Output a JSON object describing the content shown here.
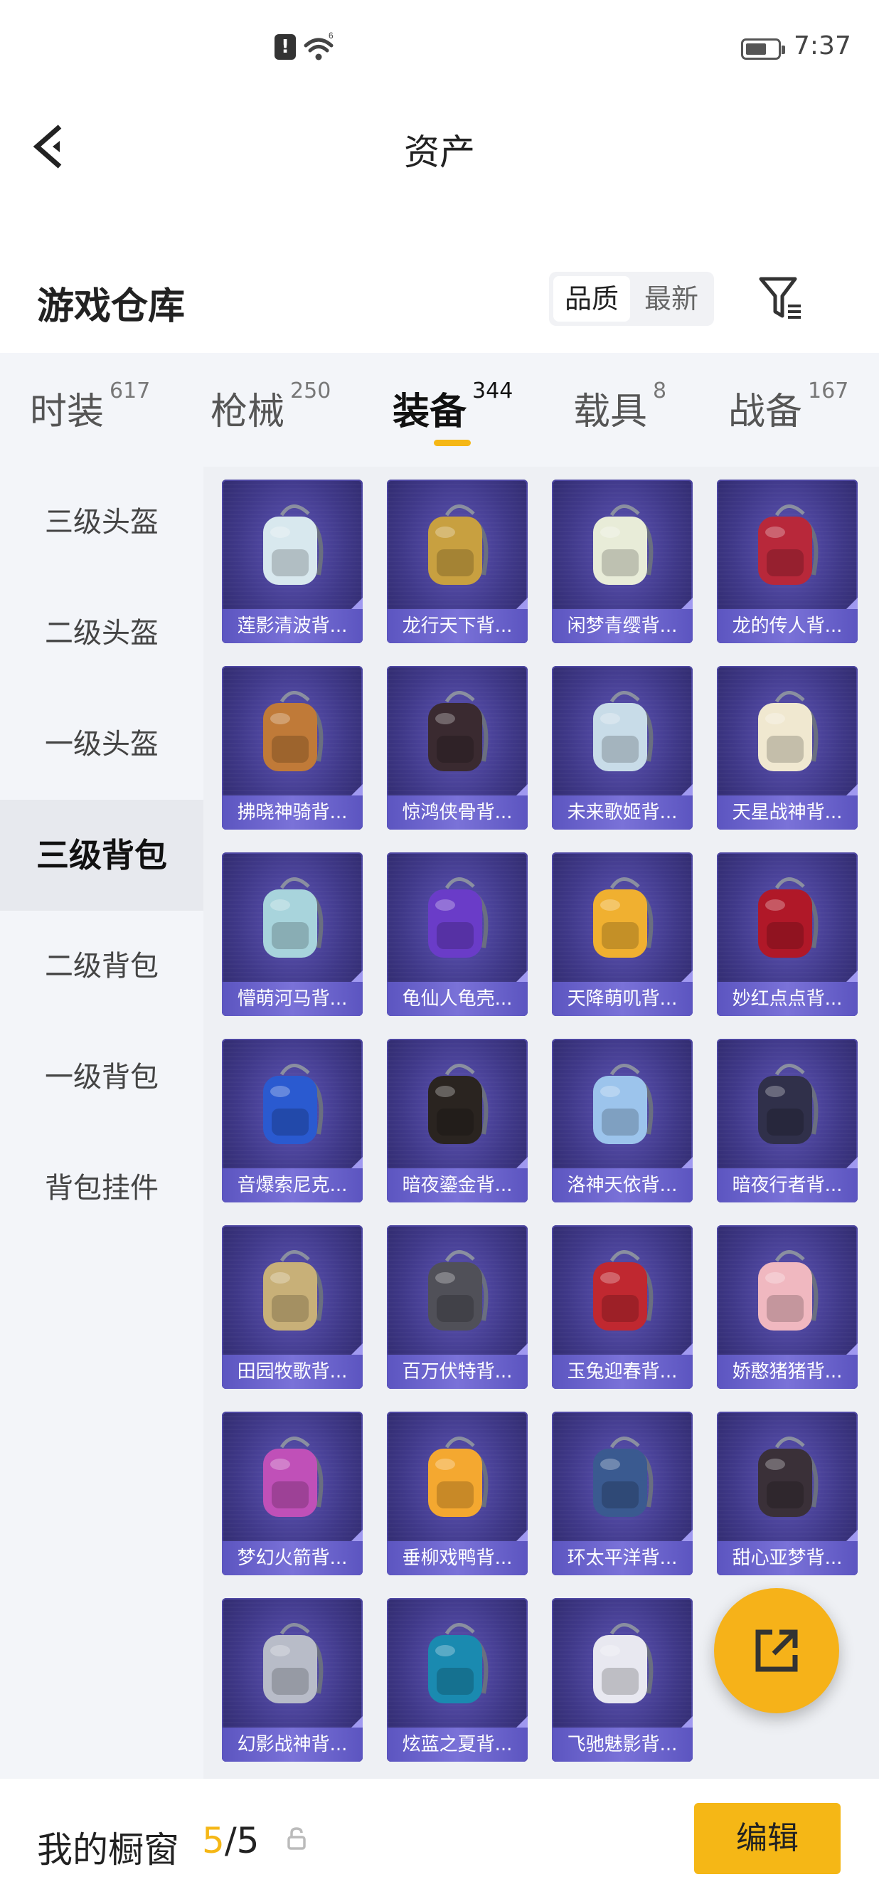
{
  "status_bar": {
    "time": "7:37",
    "alert": "!",
    "wifi_badge": "6"
  },
  "header": {
    "title": "资产"
  },
  "section": {
    "title": "游戏仓库",
    "sort_options": [
      "品质",
      "最新"
    ]
  },
  "tabs": [
    {
      "label": "时装",
      "count": "617"
    },
    {
      "label": "枪械",
      "count": "250"
    },
    {
      "label": "装备",
      "count": "344",
      "active": true
    },
    {
      "label": "载具",
      "count": "8"
    },
    {
      "label": "战备",
      "count": "167"
    }
  ],
  "sidebar": [
    {
      "label": "三级头盔"
    },
    {
      "label": "二级头盔"
    },
    {
      "label": "一级头盔"
    },
    {
      "label": "三级背包",
      "active": true
    },
    {
      "label": "二级背包"
    },
    {
      "label": "一级背包"
    },
    {
      "label": "背包挂件"
    }
  ],
  "items": [
    {
      "name": "莲影清波背...",
      "color": "#d8e8ee"
    },
    {
      "name": "龙行天下背...",
      "color": "#c8a040"
    },
    {
      "name": "闲梦青缨背...",
      "color": "#e8ecd8"
    },
    {
      "name": "龙的传人背...",
      "color": "#b8283a"
    },
    {
      "name": "拂晓神骑背...",
      "color": "#c07a38"
    },
    {
      "name": "惊鸿侠骨背...",
      "color": "#3a2a30"
    },
    {
      "name": "未来歌姬背...",
      "color": "#c8dce8"
    },
    {
      "name": "天星战神背...",
      "color": "#f0e8d0"
    },
    {
      "name": "懵萌河马背...",
      "color": "#a8d4dc"
    },
    {
      "name": "龟仙人龟壳...",
      "color": "#6a3cc8"
    },
    {
      "name": "天降萌叽背...",
      "color": "#f0b030"
    },
    {
      "name": "妙红点点背...",
      "color": "#b01828"
    },
    {
      "name": "音爆索尼克...",
      "color": "#2a5ad0"
    },
    {
      "name": "暗夜鎏金背...",
      "color": "#2a2420"
    },
    {
      "name": "洛神天依背...",
      "color": "#9cc4ec"
    },
    {
      "name": "暗夜行者背...",
      "color": "#30304a"
    },
    {
      "name": "田园牧歌背...",
      "color": "#c8b078"
    },
    {
      "name": "百万伏特背...",
      "color": "#505058"
    },
    {
      "name": "玉兔迎春背...",
      "color": "#c02830"
    },
    {
      "name": "娇憨猪猪背...",
      "color": "#f0b8c0"
    },
    {
      "name": "梦幻火箭背...",
      "color": "#c050b8"
    },
    {
      "name": "垂柳戏鸭背...",
      "color": "#f4a830"
    },
    {
      "name": "环太平洋背...",
      "color": "#3a5a90"
    },
    {
      "name": "甜心亚梦背...",
      "color": "#3a3038"
    },
    {
      "name": "幻影战神背...",
      "color": "#b8bcc8"
    },
    {
      "name": "炫蓝之夏背...",
      "color": "#1a8ab0"
    },
    {
      "name": "飞驰魅影背...",
      "color": "#e8e8f0"
    }
  ],
  "showcase": {
    "title": "我的橱窗",
    "current": "5",
    "total": "/5",
    "edit_label": "编辑"
  }
}
